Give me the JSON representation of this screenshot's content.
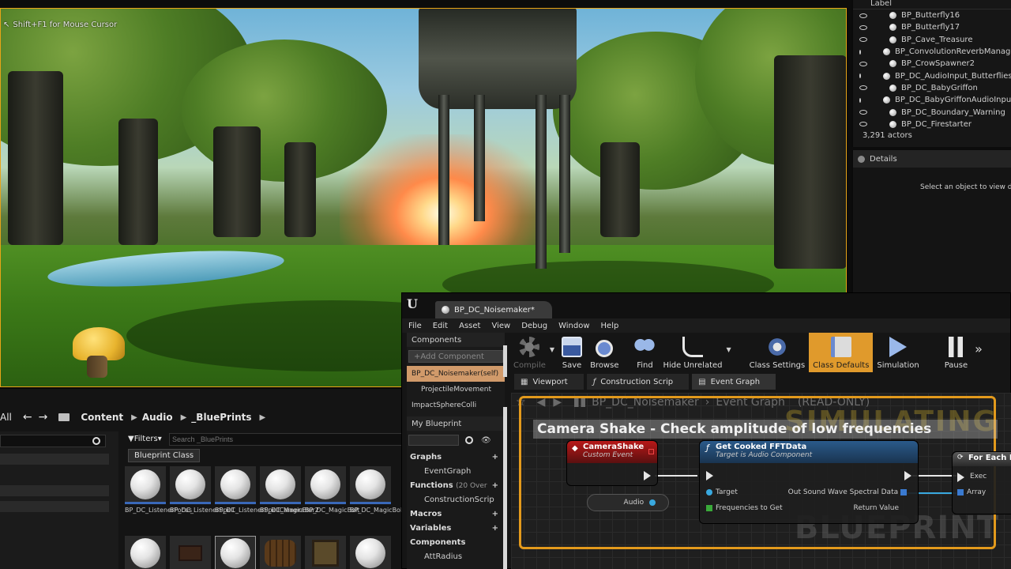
{
  "viewport": {
    "hint": "Shift+F1 for Mouse Cursor"
  },
  "outliner": {
    "column_label": "Label",
    "actors": [
      "BP_Butterfly16",
      "BP_Butterfly17",
      "BP_Cave_Treasure",
      "BP_ConvolutionReverbManager",
      "BP_CrowSpawner2",
      "BP_DC_AudioInput_Butterflies",
      "BP_DC_BabyGriffon",
      "BP_DC_BabyGriffonAudioInput",
      "BP_DC_Boundary_Warning",
      "BP_DC_Firestarter"
    ],
    "count": "3,291 actors"
  },
  "details": {
    "tab": "Details",
    "empty_message": "Select an object to view det"
  },
  "content_browser": {
    "left_label": "All",
    "path": [
      "Content",
      "Audio",
      "_BluePrints"
    ],
    "filters": "Filters",
    "search_placeholder": "Search _BluePrints",
    "filter_chip": "Blueprint Class",
    "assets": [
      {
        "name": "BP_DC_ListenerFocus"
      },
      {
        "name": "BP_DC_ListenerSpell"
      },
      {
        "name": "BP_DC_ListenerSpellCamera"
      },
      {
        "name": "BP_DC_MagicBlur2"
      },
      {
        "name": "BP_DC_MagicBolt"
      },
      {
        "name": "BP_DC_MagicBoltSpell"
      }
    ]
  },
  "blueprint": {
    "tab_title": "BP_DC_Noisemaker*",
    "menu": [
      "File",
      "Edit",
      "Asset",
      "View",
      "Debug",
      "Window",
      "Help"
    ],
    "components_panel": {
      "title": "Components",
      "add_button": "+Add Component",
      "items": [
        "BP_DC_Noisemaker(self)",
        "ProjectileMovement",
        "ImpactSphereColli"
      ]
    },
    "my_blueprint": {
      "title": "My Blueprint",
      "sections": [
        {
          "label": "Graphs",
          "children": [
            "EventGraph"
          ]
        },
        {
          "label": "Functions",
          "extra": "(20 Over",
          "children": [
            "ConstructionScrip"
          ]
        },
        {
          "label": "Macros",
          "children": []
        },
        {
          "label": "Variables",
          "children": []
        },
        {
          "label": "Components",
          "children": [
            "AttRadius"
          ]
        }
      ]
    },
    "toolbar": [
      "Compile",
      "Save",
      "Browse",
      "Find",
      "Hide Unrelated",
      "Class Settings",
      "Class Defaults",
      "Simulation",
      "Pause"
    ],
    "graph_tabs": [
      "Viewport",
      "Construction Scrip",
      "Event Graph"
    ],
    "breadcrumb": {
      "blueprint": "BP_DC_Noisemaker",
      "graph": "Event Graph",
      "mode": "(READ-ONLY)"
    },
    "watermark_sim": "SIMULATING",
    "watermark_bp": "BLUEPRINT",
    "comment": "Camera Shake - Check amplitude of low frequencies",
    "nodes": {
      "event": {
        "title": "CameraShake",
        "subtitle": "Custom Event"
      },
      "function": {
        "title": "Get Cooked FFTData",
        "subtitle": "Target is Audio Component",
        "pins": [
          "Target",
          "Frequencies to Get",
          "Out Sound Wave Spectral Data",
          "Return Value"
        ]
      },
      "loop": {
        "title": "For Each L",
        "pins": [
          "Exec",
          "Array"
        ]
      },
      "variable": {
        "label": "Audio"
      }
    }
  }
}
